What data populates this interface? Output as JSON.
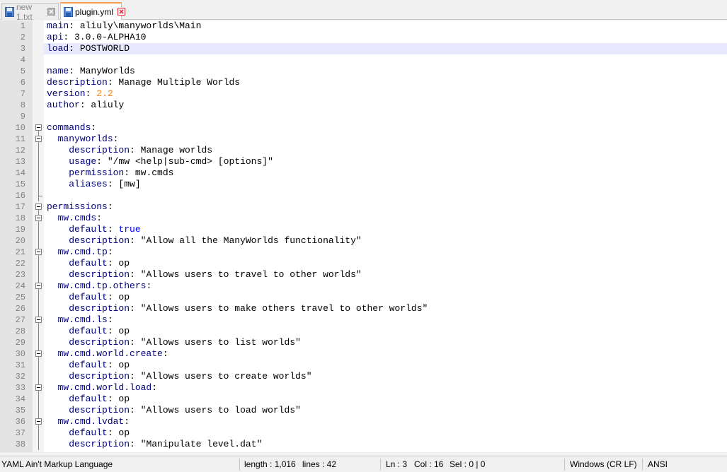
{
  "tabs": [
    {
      "label": "new 1.txt",
      "active": false,
      "saved": true
    },
    {
      "label": "plugin.yml",
      "active": true,
      "saved": true
    }
  ],
  "editor": {
    "current_line": 3,
    "lines": [
      [
        [
          "k",
          "main"
        ],
        [
          "t",
          ": aliuly\\manyworlds\\Main"
        ]
      ],
      [
        [
          "k",
          "api"
        ],
        [
          "t",
          ": 3.0.0-ALPHA10"
        ]
      ],
      [
        [
          "k",
          "load"
        ],
        [
          "t",
          ": POSTWORLD"
        ]
      ],
      [],
      [
        [
          "k",
          "name"
        ],
        [
          "t",
          ": ManyWorlds"
        ]
      ],
      [
        [
          "k",
          "description"
        ],
        [
          "t",
          ": Manage Multiple Worlds"
        ]
      ],
      [
        [
          "k",
          "version"
        ],
        [
          "t",
          ": "
        ],
        [
          "n",
          "2.2"
        ]
      ],
      [
        [
          "k",
          "author"
        ],
        [
          "t",
          ": aliuly"
        ]
      ],
      [],
      [
        [
          "k",
          "commands"
        ],
        [
          "t",
          ":"
        ]
      ],
      [
        [
          "t",
          "  "
        ],
        [
          "k",
          "manyworlds"
        ],
        [
          "t",
          ":"
        ]
      ],
      [
        [
          "t",
          "    "
        ],
        [
          "k",
          "description"
        ],
        [
          "t",
          ": Manage worlds"
        ]
      ],
      [
        [
          "t",
          "    "
        ],
        [
          "k",
          "usage"
        ],
        [
          "t",
          ": \"/mw <help|sub-cmd> [options]\""
        ]
      ],
      [
        [
          "t",
          "    "
        ],
        [
          "k",
          "permission"
        ],
        [
          "t",
          ": mw.cmds"
        ]
      ],
      [
        [
          "t",
          "    "
        ],
        [
          "k",
          "aliases"
        ],
        [
          "t",
          ": [mw]"
        ]
      ],
      [],
      [
        [
          "k",
          "permissions"
        ],
        [
          "t",
          ":"
        ]
      ],
      [
        [
          "t",
          "  "
        ],
        [
          "k",
          "mw.cmds"
        ],
        [
          "t",
          ":"
        ]
      ],
      [
        [
          "t",
          "    "
        ],
        [
          "k",
          "default"
        ],
        [
          "t",
          ": "
        ],
        [
          "w",
          "true"
        ]
      ],
      [
        [
          "t",
          "    "
        ],
        [
          "k",
          "description"
        ],
        [
          "t",
          ": \"Allow all the ManyWorlds functionality\""
        ]
      ],
      [
        [
          "t",
          "  "
        ],
        [
          "k",
          "mw.cmd.tp"
        ],
        [
          "t",
          ":"
        ]
      ],
      [
        [
          "t",
          "    "
        ],
        [
          "k",
          "default"
        ],
        [
          "t",
          ": op"
        ]
      ],
      [
        [
          "t",
          "    "
        ],
        [
          "k",
          "description"
        ],
        [
          "t",
          ": \"Allows users to travel to other worlds\""
        ]
      ],
      [
        [
          "t",
          "  "
        ],
        [
          "k",
          "mw.cmd.tp.others"
        ],
        [
          "t",
          ":"
        ]
      ],
      [
        [
          "t",
          "    "
        ],
        [
          "k",
          "default"
        ],
        [
          "t",
          ": op"
        ]
      ],
      [
        [
          "t",
          "    "
        ],
        [
          "k",
          "description"
        ],
        [
          "t",
          ": \"Allows users to make others travel to other worlds\""
        ]
      ],
      [
        [
          "t",
          "  "
        ],
        [
          "k",
          "mw.cmd.ls"
        ],
        [
          "t",
          ":"
        ]
      ],
      [
        [
          "t",
          "    "
        ],
        [
          "k",
          "default"
        ],
        [
          "t",
          ": op"
        ]
      ],
      [
        [
          "t",
          "    "
        ],
        [
          "k",
          "description"
        ],
        [
          "t",
          ": \"Allows users to list worlds\""
        ]
      ],
      [
        [
          "t",
          "  "
        ],
        [
          "k",
          "mw.cmd.world.create"
        ],
        [
          "t",
          ":"
        ]
      ],
      [
        [
          "t",
          "    "
        ],
        [
          "k",
          "default"
        ],
        [
          "t",
          ": op"
        ]
      ],
      [
        [
          "t",
          "    "
        ],
        [
          "k",
          "description"
        ],
        [
          "t",
          ": \"Allows users to create worlds\""
        ]
      ],
      [
        [
          "t",
          "  "
        ],
        [
          "k",
          "mw.cmd.world.load"
        ],
        [
          "t",
          ":"
        ]
      ],
      [
        [
          "t",
          "    "
        ],
        [
          "k",
          "default"
        ],
        [
          "t",
          ": op"
        ]
      ],
      [
        [
          "t",
          "    "
        ],
        [
          "k",
          "description"
        ],
        [
          "t",
          ": \"Allows users to load worlds\""
        ]
      ],
      [
        [
          "t",
          "  "
        ],
        [
          "k",
          "mw.cmd.lvdat"
        ],
        [
          "t",
          ":"
        ]
      ],
      [
        [
          "t",
          "    "
        ],
        [
          "k",
          "default"
        ],
        [
          "t",
          ": op"
        ]
      ],
      [
        [
          "t",
          "    "
        ],
        [
          "k",
          "description"
        ],
        [
          "t",
          ": \"Manipulate level.dat\""
        ]
      ]
    ],
    "fold_starts": [
      10,
      11,
      17,
      18,
      21,
      24,
      27,
      30,
      33,
      36
    ]
  },
  "statusbar": {
    "language": "YAML Ain't Markup Language",
    "length": "length : 1,016",
    "lines": "lines : 42",
    "ln": "Ln : 3",
    "col": "Col : 16",
    "sel": "Sel : 0 | 0",
    "eol": "Windows (CR LF)",
    "encoding": "ANSI"
  },
  "colors": {
    "key": "#000080",
    "number": "#ff8000",
    "keyword": "#0000ff",
    "current_line": "#e8e8ff",
    "active_tab_accent": "#f6a04d",
    "close_icon": "#e0303a"
  },
  "icons": {
    "saved_file": "floppy-disk-icon",
    "close": "tab-close-icon",
    "fold": "fold-minus-icon"
  }
}
